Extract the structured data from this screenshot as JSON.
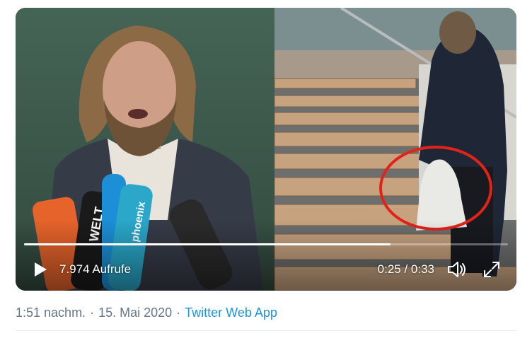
{
  "video": {
    "views_label": "7.974 Aufrufe",
    "time_label": "0:25 / 0:33",
    "progress_fraction": 0.757,
    "thumbnail_text": {
      "mic_left": "WELT",
      "mic_right": "phoenix"
    },
    "icons": {
      "play": "play-icon",
      "volume": "volume-icon",
      "fullscreen": "fullscreen-icon"
    },
    "colors": {
      "highlight_circle": "#e2231a",
      "controls": "#ffffff"
    }
  },
  "tweet_meta": {
    "time": "1:51 nachm.",
    "separator": "·",
    "date": "15. Mai 2020",
    "source": "Twitter Web App",
    "source_color": "#1b95e0"
  }
}
